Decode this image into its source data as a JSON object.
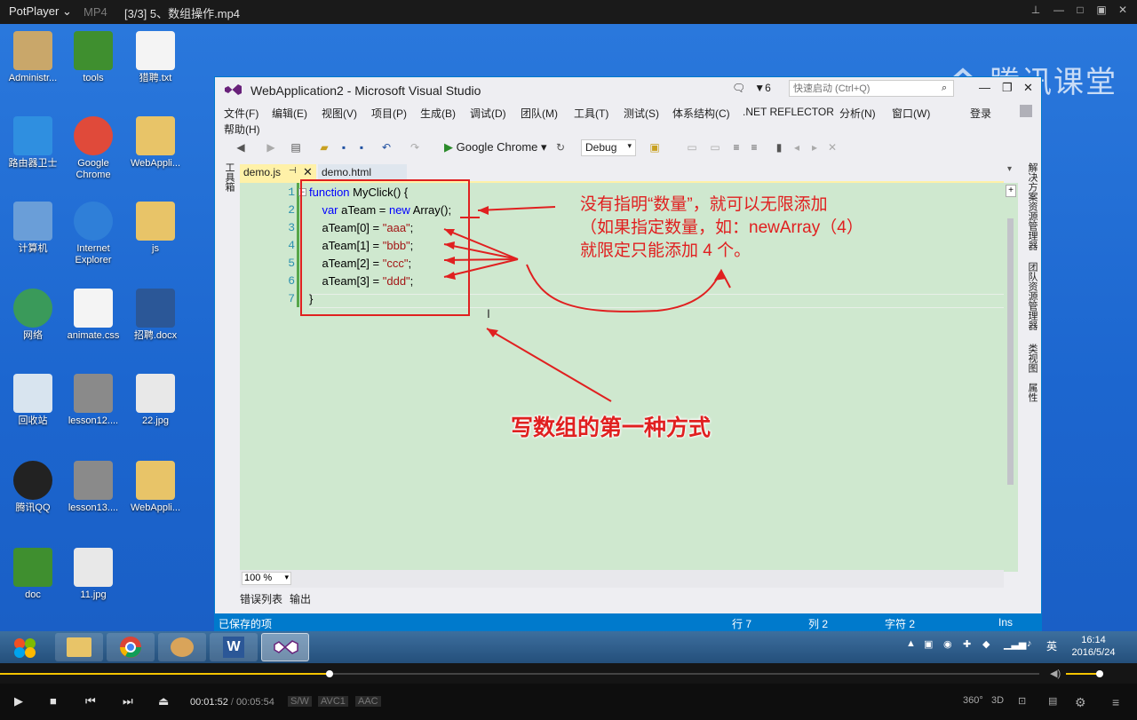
{
  "player": {
    "brand": "PotPlayer ⌄",
    "format": "MP4",
    "file_title": "[3/3] 5、数组操作.mp4",
    "time_current": "00:01:52",
    "time_separator": "/",
    "time_total": "00:05:54",
    "tags": [
      "S/W",
      "AVC1",
      "AAC"
    ],
    "right_icons": [
      "360°",
      "3D"
    ],
    "progress_fraction": 0.317,
    "volume_fraction": 0.85
  },
  "desktop": {
    "watermark": "腾讯课堂",
    "icons": [
      {
        "label": "Administr...",
        "icon": "user-folder-icon"
      },
      {
        "label": "tools",
        "icon": "tree-icon"
      },
      {
        "label": "猎聘.txt",
        "icon": "text-file-icon"
      },
      {
        "label": "路由器卫士",
        "icon": "router-icon"
      },
      {
        "label": "Google Chrome",
        "icon": "chrome-icon"
      },
      {
        "label": "WebAppli...",
        "icon": "folder-icon"
      },
      {
        "label": "计算机",
        "icon": "computer-icon"
      },
      {
        "label": "Internet Explorer",
        "icon": "ie-icon"
      },
      {
        "label": "js",
        "icon": "folder-icon"
      },
      {
        "label": "网络",
        "icon": "network-icon"
      },
      {
        "label": "animate.css",
        "icon": "file-icon"
      },
      {
        "label": "招聘.docx",
        "icon": "word-doc-icon"
      },
      {
        "label": "回收站",
        "icon": "recycle-bin-icon"
      },
      {
        "label": "lesson12....",
        "icon": "video-camera-icon"
      },
      {
        "label": "22.jpg",
        "icon": "image-icon"
      },
      {
        "label": "腾讯QQ",
        "icon": "qq-icon"
      },
      {
        "label": "lesson13....",
        "icon": "video-camera-icon"
      },
      {
        "label": "WebAppli...",
        "icon": "folder-icon"
      },
      {
        "label": "doc",
        "icon": "tree-icon"
      },
      {
        "label": "11.jpg",
        "icon": "image-icon"
      }
    ]
  },
  "vs": {
    "title": "WebApplication2 - Microsoft Visual Studio",
    "notif_count": "6",
    "quick_launch_placeholder": "快速启动 (Ctrl+Q)",
    "menu": [
      "文件(F)",
      "编辑(E)",
      "视图(V)",
      "项目(P)",
      "生成(B)",
      "调试(D)",
      "团队(M)",
      "工具(T)",
      "测试(S)",
      "体系结构(C)",
      ".NET REFLECTOR",
      "分析(N)",
      "窗口(W)",
      "帮助(H)"
    ],
    "login": "登录",
    "run_target": "Google Chrome",
    "config": "Debug",
    "left_strip": "工具箱",
    "right_strip": [
      "解决方案资源管理器",
      "团队资源管理器",
      "类视图",
      "属性"
    ],
    "tabs": [
      {
        "label": "demo.js",
        "active": true
      },
      {
        "label": "demo.html",
        "active": false
      }
    ],
    "line_numbers": [
      "1",
      "2",
      "3",
      "4",
      "5",
      "6",
      "7"
    ],
    "zoom": "100 %",
    "bottom_tabs": [
      "错误列表",
      "输出"
    ],
    "status": {
      "left": "已保存的项",
      "line": "行 7",
      "col": "列 2",
      "char": "字符 2",
      "mode": "Ins"
    }
  },
  "annotations": {
    "note1": "没有指明“数量”，就可以无限添加",
    "note2": "（如果指定数量，如：newArray（4）",
    "note3": "就限定只能添加 4 个。",
    "headline": "写数组的第一种方式"
  },
  "taskbar": {
    "time": "16:14",
    "date": "2016/5/24",
    "ime": "英"
  }
}
